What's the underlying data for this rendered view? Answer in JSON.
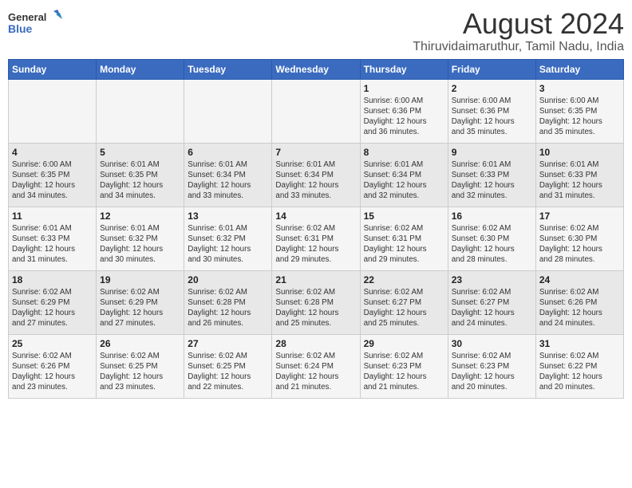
{
  "header": {
    "logo_line1": "General",
    "logo_line2": "Blue",
    "title": "August 2024",
    "subtitle": "Thiruvidaimaruthur, Tamil Nadu, India"
  },
  "weekdays": [
    "Sunday",
    "Monday",
    "Tuesday",
    "Wednesday",
    "Thursday",
    "Friday",
    "Saturday"
  ],
  "weeks": [
    [
      {
        "day": "",
        "info": ""
      },
      {
        "day": "",
        "info": ""
      },
      {
        "day": "",
        "info": ""
      },
      {
        "day": "",
        "info": ""
      },
      {
        "day": "1",
        "info": "Sunrise: 6:00 AM\nSunset: 6:36 PM\nDaylight: 12 hours\nand 36 minutes."
      },
      {
        "day": "2",
        "info": "Sunrise: 6:00 AM\nSunset: 6:36 PM\nDaylight: 12 hours\nand 35 minutes."
      },
      {
        "day": "3",
        "info": "Sunrise: 6:00 AM\nSunset: 6:35 PM\nDaylight: 12 hours\nand 35 minutes."
      }
    ],
    [
      {
        "day": "4",
        "info": "Sunrise: 6:00 AM\nSunset: 6:35 PM\nDaylight: 12 hours\nand 34 minutes."
      },
      {
        "day": "5",
        "info": "Sunrise: 6:01 AM\nSunset: 6:35 PM\nDaylight: 12 hours\nand 34 minutes."
      },
      {
        "day": "6",
        "info": "Sunrise: 6:01 AM\nSunset: 6:34 PM\nDaylight: 12 hours\nand 33 minutes."
      },
      {
        "day": "7",
        "info": "Sunrise: 6:01 AM\nSunset: 6:34 PM\nDaylight: 12 hours\nand 33 minutes."
      },
      {
        "day": "8",
        "info": "Sunrise: 6:01 AM\nSunset: 6:34 PM\nDaylight: 12 hours\nand 32 minutes."
      },
      {
        "day": "9",
        "info": "Sunrise: 6:01 AM\nSunset: 6:33 PM\nDaylight: 12 hours\nand 32 minutes."
      },
      {
        "day": "10",
        "info": "Sunrise: 6:01 AM\nSunset: 6:33 PM\nDaylight: 12 hours\nand 31 minutes."
      }
    ],
    [
      {
        "day": "11",
        "info": "Sunrise: 6:01 AM\nSunset: 6:33 PM\nDaylight: 12 hours\nand 31 minutes."
      },
      {
        "day": "12",
        "info": "Sunrise: 6:01 AM\nSunset: 6:32 PM\nDaylight: 12 hours\nand 30 minutes."
      },
      {
        "day": "13",
        "info": "Sunrise: 6:01 AM\nSunset: 6:32 PM\nDaylight: 12 hours\nand 30 minutes."
      },
      {
        "day": "14",
        "info": "Sunrise: 6:02 AM\nSunset: 6:31 PM\nDaylight: 12 hours\nand 29 minutes."
      },
      {
        "day": "15",
        "info": "Sunrise: 6:02 AM\nSunset: 6:31 PM\nDaylight: 12 hours\nand 29 minutes."
      },
      {
        "day": "16",
        "info": "Sunrise: 6:02 AM\nSunset: 6:30 PM\nDaylight: 12 hours\nand 28 minutes."
      },
      {
        "day": "17",
        "info": "Sunrise: 6:02 AM\nSunset: 6:30 PM\nDaylight: 12 hours\nand 28 minutes."
      }
    ],
    [
      {
        "day": "18",
        "info": "Sunrise: 6:02 AM\nSunset: 6:29 PM\nDaylight: 12 hours\nand 27 minutes."
      },
      {
        "day": "19",
        "info": "Sunrise: 6:02 AM\nSunset: 6:29 PM\nDaylight: 12 hours\nand 27 minutes."
      },
      {
        "day": "20",
        "info": "Sunrise: 6:02 AM\nSunset: 6:28 PM\nDaylight: 12 hours\nand 26 minutes."
      },
      {
        "day": "21",
        "info": "Sunrise: 6:02 AM\nSunset: 6:28 PM\nDaylight: 12 hours\nand 25 minutes."
      },
      {
        "day": "22",
        "info": "Sunrise: 6:02 AM\nSunset: 6:27 PM\nDaylight: 12 hours\nand 25 minutes."
      },
      {
        "day": "23",
        "info": "Sunrise: 6:02 AM\nSunset: 6:27 PM\nDaylight: 12 hours\nand 24 minutes."
      },
      {
        "day": "24",
        "info": "Sunrise: 6:02 AM\nSunset: 6:26 PM\nDaylight: 12 hours\nand 24 minutes."
      }
    ],
    [
      {
        "day": "25",
        "info": "Sunrise: 6:02 AM\nSunset: 6:26 PM\nDaylight: 12 hours\nand 23 minutes."
      },
      {
        "day": "26",
        "info": "Sunrise: 6:02 AM\nSunset: 6:25 PM\nDaylight: 12 hours\nand 23 minutes."
      },
      {
        "day": "27",
        "info": "Sunrise: 6:02 AM\nSunset: 6:25 PM\nDaylight: 12 hours\nand 22 minutes."
      },
      {
        "day": "28",
        "info": "Sunrise: 6:02 AM\nSunset: 6:24 PM\nDaylight: 12 hours\nand 21 minutes."
      },
      {
        "day": "29",
        "info": "Sunrise: 6:02 AM\nSunset: 6:23 PM\nDaylight: 12 hours\nand 21 minutes."
      },
      {
        "day": "30",
        "info": "Sunrise: 6:02 AM\nSunset: 6:23 PM\nDaylight: 12 hours\nand 20 minutes."
      },
      {
        "day": "31",
        "info": "Sunrise: 6:02 AM\nSunset: 6:22 PM\nDaylight: 12 hours\nand 20 minutes."
      }
    ]
  ]
}
